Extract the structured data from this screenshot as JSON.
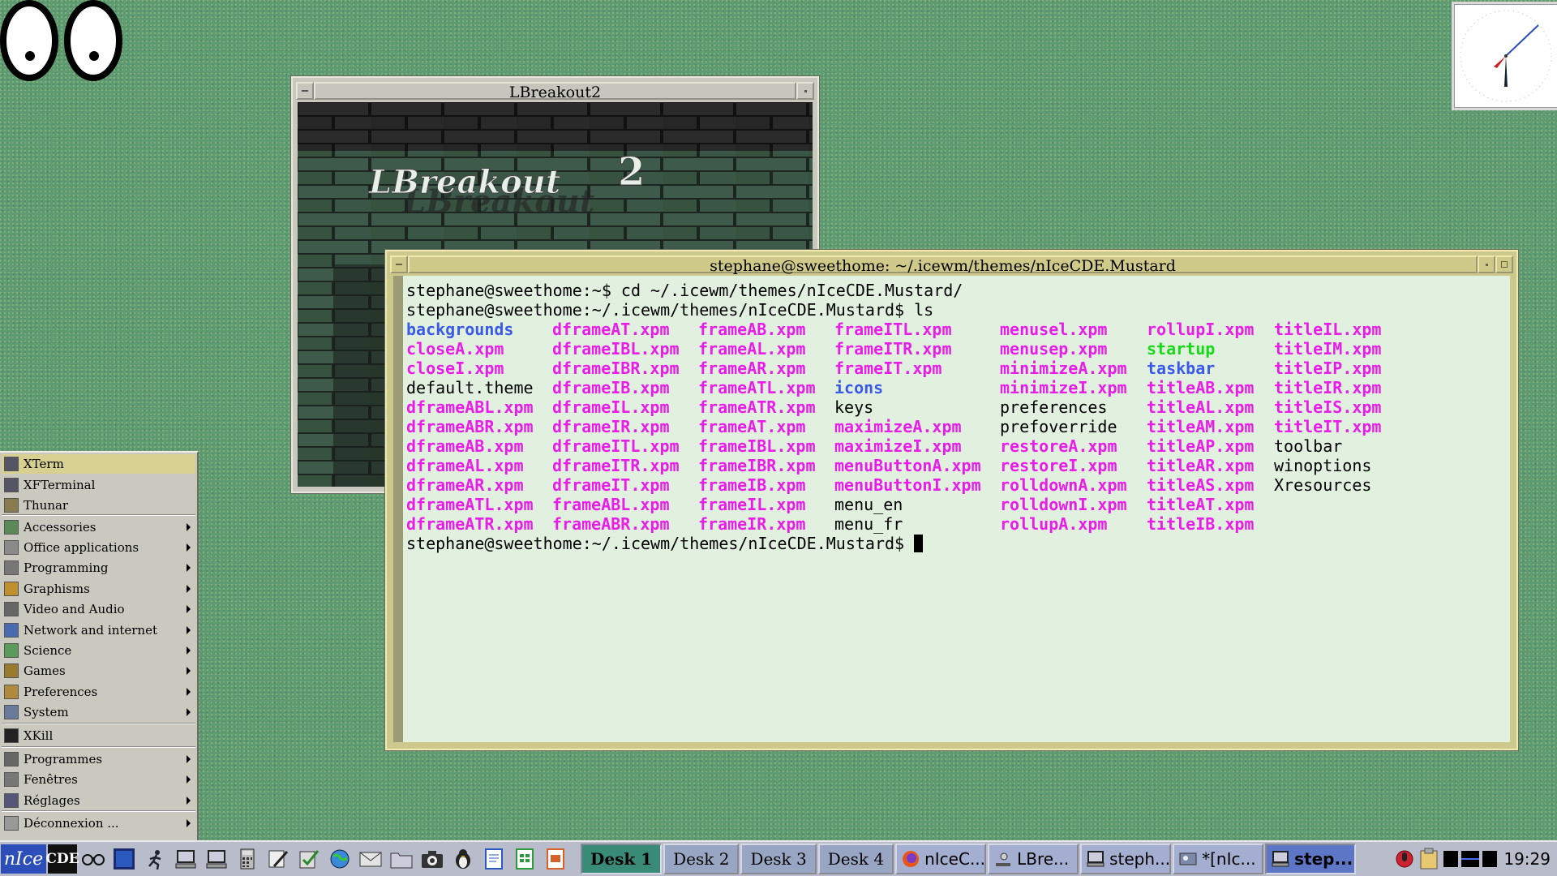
{
  "lbreakout_window": {
    "title": "LBreakout2",
    "logo_text": "LBreakout",
    "logo_number": "2"
  },
  "terminal_window": {
    "title": "stephane@sweethome: ~/.icewm/themes/nIceCDE.Mustard",
    "line1": "stephane@sweethome:~$ cd ~/.icewm/themes/nIceCDE.Mustard/",
    "line2": "stephane@sweethome:~/.icewm/themes/nIceCDE.Mustard$ ls",
    "prompt": "stephane@sweethome:~/.icewm/themes/nIceCDE.Mustard$ ",
    "ls_rows": [
      [
        [
          "backgrounds",
          "dir"
        ],
        [
          "dframeAT.xpm",
          "xpm"
        ],
        [
          "frameAB.xpm",
          "xpm"
        ],
        [
          "frameITL.xpm",
          "xpm"
        ],
        [
          "menusel.xpm",
          "xpm"
        ],
        [
          "rollupI.xpm",
          "xpm"
        ],
        [
          "titleIL.xpm",
          "xpm"
        ]
      ],
      [
        [
          "closeA.xpm",
          "xpm"
        ],
        [
          "dframeIBL.xpm",
          "xpm"
        ],
        [
          "frameAL.xpm",
          "xpm"
        ],
        [
          "frameITR.xpm",
          "xpm"
        ],
        [
          "menusep.xpm",
          "xpm"
        ],
        [
          "startup",
          "exec"
        ],
        [
          "titleIM.xpm",
          "xpm"
        ]
      ],
      [
        [
          "closeI.xpm",
          "xpm"
        ],
        [
          "dframeIBR.xpm",
          "xpm"
        ],
        [
          "frameAR.xpm",
          "xpm"
        ],
        [
          "frameIT.xpm",
          "xpm"
        ],
        [
          "minimizeA.xpm",
          "xpm"
        ],
        [
          "taskbar",
          "dir"
        ],
        [
          "titleIP.xpm",
          "xpm"
        ]
      ],
      [
        [
          "default.theme",
          "file"
        ],
        [
          "dframeIB.xpm",
          "xpm"
        ],
        [
          "frameATL.xpm",
          "xpm"
        ],
        [
          "icons",
          "dir"
        ],
        [
          "minimizeI.xpm",
          "xpm"
        ],
        [
          "titleAB.xpm",
          "xpm"
        ],
        [
          "titleIR.xpm",
          "xpm"
        ]
      ],
      [
        [
          "dframeABL.xpm",
          "xpm"
        ],
        [
          "dframeIL.xpm",
          "xpm"
        ],
        [
          "frameATR.xpm",
          "xpm"
        ],
        [
          "keys",
          "file"
        ],
        [
          "preferences",
          "file"
        ],
        [
          "titleAL.xpm",
          "xpm"
        ],
        [
          "titleIS.xpm",
          "xpm"
        ]
      ],
      [
        [
          "dframeABR.xpm",
          "xpm"
        ],
        [
          "dframeIR.xpm",
          "xpm"
        ],
        [
          "frameAT.xpm",
          "xpm"
        ],
        [
          "maximizeA.xpm",
          "xpm"
        ],
        [
          "prefoverride",
          "file"
        ],
        [
          "titleAM.xpm",
          "xpm"
        ],
        [
          "titleIT.xpm",
          "xpm"
        ]
      ],
      [
        [
          "dframeAB.xpm",
          "xpm"
        ],
        [
          "dframeITL.xpm",
          "xpm"
        ],
        [
          "frameIBL.xpm",
          "xpm"
        ],
        [
          "maximizeI.xpm",
          "xpm"
        ],
        [
          "restoreA.xpm",
          "xpm"
        ],
        [
          "titleAP.xpm",
          "xpm"
        ],
        [
          "toolbar",
          "file"
        ]
      ],
      [
        [
          "dframeAL.xpm",
          "xpm"
        ],
        [
          "dframeITR.xpm",
          "xpm"
        ],
        [
          "frameIBR.xpm",
          "xpm"
        ],
        [
          "menuButtonA.xpm",
          "xpm"
        ],
        [
          "restoreI.xpm",
          "xpm"
        ],
        [
          "titleAR.xpm",
          "xpm"
        ],
        [
          "winoptions",
          "file"
        ]
      ],
      [
        [
          "dframeAR.xpm",
          "xpm"
        ],
        [
          "dframeIT.xpm",
          "xpm"
        ],
        [
          "frameIB.xpm",
          "xpm"
        ],
        [
          "menuButtonI.xpm",
          "xpm"
        ],
        [
          "rolldownA.xpm",
          "xpm"
        ],
        [
          "titleAS.xpm",
          "xpm"
        ],
        [
          "Xresources",
          "file"
        ]
      ],
      [
        [
          "dframeATL.xpm",
          "xpm"
        ],
        [
          "frameABL.xpm",
          "xpm"
        ],
        [
          "frameIL.xpm",
          "xpm"
        ],
        [
          "menu_en",
          "file"
        ],
        [
          "rolldownI.xpm",
          "xpm"
        ],
        [
          "titleAT.xpm",
          "xpm"
        ],
        [
          "",
          ""
        ]
      ],
      [
        [
          "dframeATR.xpm",
          "xpm"
        ],
        [
          "frameABR.xpm",
          "xpm"
        ],
        [
          "frameIR.xpm",
          "xpm"
        ],
        [
          "menu_fr",
          "file"
        ],
        [
          "rollupA.xpm",
          "xpm"
        ],
        [
          "titleIB.xpm",
          "xpm"
        ],
        [
          "",
          ""
        ]
      ]
    ]
  },
  "start_menu": {
    "items": [
      {
        "label": "XTerm",
        "icon": "terminal-icon",
        "submenu": false,
        "selected": true
      },
      {
        "label": "XFTerminal",
        "icon": "terminal-icon",
        "submenu": false
      },
      {
        "label": "Thunar",
        "icon": "file-manager-icon",
        "submenu": false
      },
      {
        "label": "Accessories",
        "icon": "accessories-icon",
        "submenu": true
      },
      {
        "label": "Office applications",
        "icon": "office-icon",
        "submenu": true
      },
      {
        "label": "Programming",
        "icon": "programming-icon",
        "submenu": true
      },
      {
        "label": "Graphisms",
        "icon": "graphics-icon",
        "submenu": true
      },
      {
        "label": "Video and Audio",
        "icon": "multimedia-icon",
        "submenu": true
      },
      {
        "label": "Network and internet",
        "icon": "network-icon",
        "submenu": true
      },
      {
        "label": "Science",
        "icon": "science-icon",
        "submenu": true
      },
      {
        "label": "Games",
        "icon": "games-icon",
        "submenu": true
      },
      {
        "label": "Preferences",
        "icon": "preferences-icon",
        "submenu": true
      },
      {
        "label": "System",
        "icon": "system-icon",
        "submenu": true
      },
      {
        "label": "XKill",
        "icon": "bomb-icon",
        "submenu": false
      },
      {
        "label": "Programmes",
        "icon": "programs-icon",
        "submenu": true
      },
      {
        "label": "Fenêtres",
        "icon": "windows-icon",
        "submenu": true
      },
      {
        "label": "Réglages",
        "icon": "settings-icon",
        "submenu": true
      },
      {
        "label": "Déconnexion ...",
        "icon": "logout-icon",
        "submenu": true
      }
    ]
  },
  "taskbar": {
    "start_label": "nIce",
    "cde_label": "CDE",
    "desks": [
      "Desk 1",
      "Desk 2",
      "Desk 3",
      "Desk 4"
    ],
    "active_desk": "Desk 1",
    "tasks": [
      {
        "label": "nIceC...",
        "icon": "firefox-icon"
      },
      {
        "label": "LBre...",
        "icon": "lbreakout-icon"
      },
      {
        "label": "steph...",
        "icon": "terminal-icon"
      },
      {
        "label": "*[nIc...",
        "icon": "image-editor-icon"
      },
      {
        "label": "step...",
        "icon": "terminal-icon",
        "active": true
      }
    ],
    "time": "19:29"
  },
  "colors": {
    "desktop": "#5e9a72",
    "xpm_file": "#e81ee8",
    "directory": "#3c5ae8",
    "executable": "#17d917",
    "terminal_bg": "#e1f0df",
    "mustard_frame": "#cdc88c",
    "menu_selected": "#d8d091",
    "taskbar": "#b9bccb",
    "active_desk": "#3a8a78"
  }
}
